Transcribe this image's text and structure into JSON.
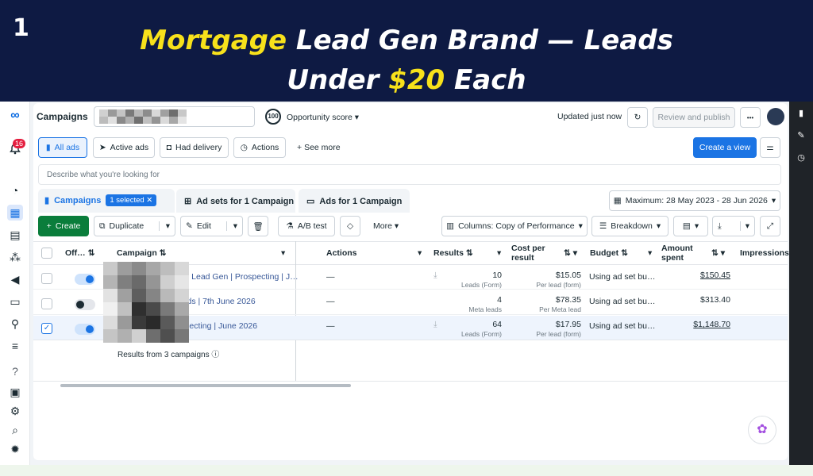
{
  "banner": {
    "slide_number": "1",
    "title_highlight_1": "Mortgage",
    "title_part_1": " Lead Gen Brand — Leads",
    "title_part_2": "Under ",
    "title_highlight_2": "$20",
    "title_part_3": " Each"
  },
  "header": {
    "title": "Campaigns",
    "account_id": "(150010467…",
    "opportunity_score": "100",
    "opportunity_label": "Opportunity score",
    "updated": "Updated just now",
    "review_publish": "Review and publish",
    "more": "•••"
  },
  "nav": {
    "notification_count": "16"
  },
  "filters": {
    "all_ads": "All ads",
    "active_ads": "Active ads",
    "had_delivery": "Had delivery",
    "actions": "Actions",
    "see_more": "See more",
    "create_view": "Create a view"
  },
  "search": {
    "placeholder": "Describe what you're looking for"
  },
  "tabs": {
    "campaigns": "Campaigns",
    "selected": "1 selected",
    "ad_sets": "Ad sets for 1 Campaign",
    "ads": "Ads for 1 Campaign",
    "date_range": "Maximum: 28 May 2023 - 28 Jun 2026"
  },
  "toolbar": {
    "create": "Create",
    "duplicate": "Duplicate",
    "edit": "Edit",
    "ab_test": "A/B test",
    "more": "More",
    "columns": "Columns: Copy of Performance",
    "breakdown": "Breakdown"
  },
  "columns": {
    "off": "Off…",
    "campaign": "Campaign",
    "actions": "Actions",
    "results": "Results",
    "cost_per_result": "Cost per result",
    "budget": "Budget",
    "amount_spent": "Amount spent",
    "impressions": "Impressions"
  },
  "rows": [
    {
      "on": true,
      "checked": false,
      "campaign": "ted | Lead Gen | Prospecting | J…",
      "actions": "—",
      "results": "10",
      "results_sub": "Leads (Form)",
      "cost": "$15.05",
      "cost_sub": "Per lead (form)",
      "budget": "Using ad set bu…",
      "spent": "$150.45"
    },
    {
      "on": false,
      "checked": false,
      "campaign": "Leads | 7th June 2026",
      "actions": "—",
      "results": "4",
      "results_sub": "Meta leads",
      "cost": "$78.35",
      "cost_sub": "Per Meta lead",
      "budget": "Using ad set bu…",
      "spent": "$313.40"
    },
    {
      "on": true,
      "checked": true,
      "campaign": "rospecting | June 2026",
      "actions": "—",
      "results": "64",
      "results_sub": "Leads (Form)",
      "cost": "$17.95",
      "cost_sub": "Per lead (form)",
      "budget": "Using ad set bu…",
      "spent": "$1,148.70"
    }
  ],
  "footer": {
    "results_from": "Results from 3 campaigns"
  },
  "colors": {
    "accent": "#1b74e4",
    "banner_bg": "#0e1a43",
    "highlight": "#f7e11b",
    "create_green": "#0a7d3b"
  }
}
